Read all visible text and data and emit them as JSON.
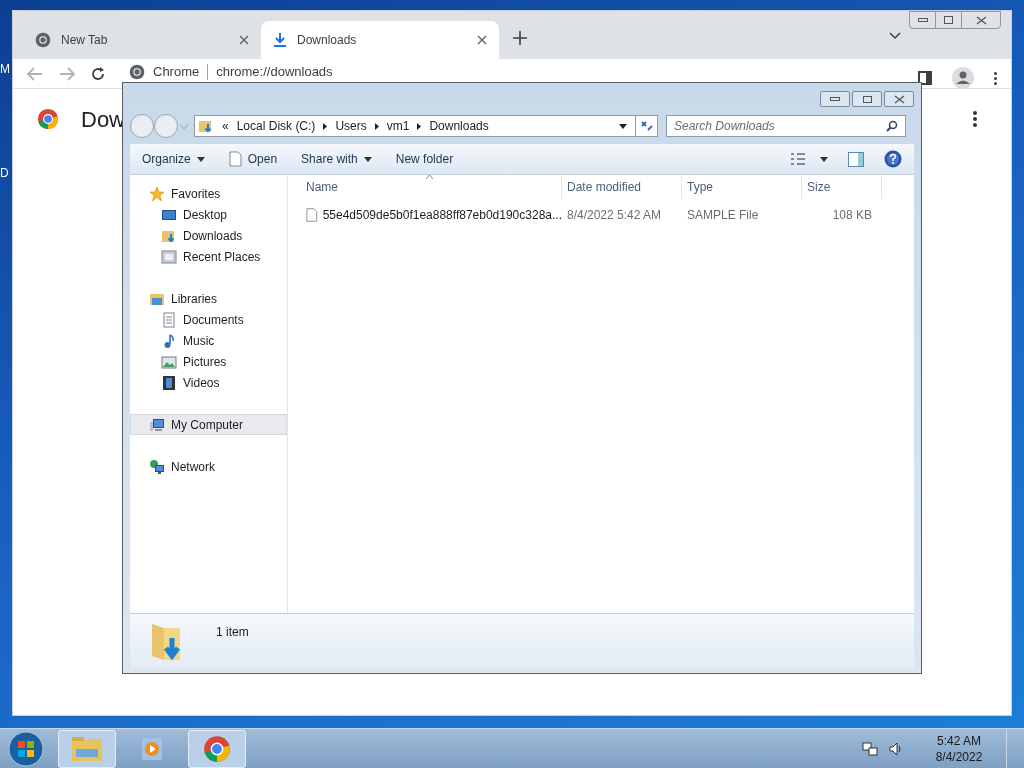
{
  "desktop_labels": [
    "M",
    "D"
  ],
  "browser": {
    "tabs": [
      {
        "title": "New Tab",
        "selected": false,
        "kind": "chrome"
      },
      {
        "title": "Downloads",
        "selected": true,
        "kind": "download"
      }
    ],
    "omnibox": {
      "chip": "Chrome",
      "url": "chrome://downloads"
    },
    "page_title": "Dow"
  },
  "explorer": {
    "breadcrumb_overflow": "«",
    "breadcrumb": [
      "Local Disk (C:)",
      "Users",
      "vm1",
      "Downloads"
    ],
    "search": {
      "placeholder": "Search Downloads"
    },
    "commands": [
      {
        "label": "Organize",
        "kind": "menu"
      },
      {
        "label": "Open",
        "kind": "open"
      },
      {
        "label": "Share with",
        "kind": "menu"
      },
      {
        "label": "New folder",
        "kind": "plain"
      }
    ],
    "nav": [
      {
        "label": "Favorites",
        "kind": "star",
        "selected": false,
        "children": [
          {
            "label": "Desktop",
            "kind": "desktop",
            "selected": false
          },
          {
            "label": "Downloads",
            "kind": "downloads",
            "selected": false
          },
          {
            "label": "Recent Places",
            "kind": "recent",
            "selected": false
          }
        ]
      },
      {
        "label": "Libraries",
        "kind": "library",
        "selected": false,
        "children": [
          {
            "label": "Documents",
            "kind": "document",
            "selected": false
          },
          {
            "label": "Music",
            "kind": "music",
            "selected": false
          },
          {
            "label": "Pictures",
            "kind": "pictures",
            "selected": false
          },
          {
            "label": "Videos",
            "kind": "video",
            "selected": false
          }
        ]
      },
      {
        "label": "My Computer",
        "kind": "computer",
        "selected": true
      },
      {
        "label": "Network",
        "kind": "network",
        "selected": false
      }
    ],
    "columns": [
      "Name",
      "Date modified",
      "Type",
      "Size"
    ],
    "rows": [
      {
        "name": "55e4d509de5b0f1ea888ff87eb0d190c328a...",
        "date": "8/4/2022 5:42 AM",
        "type": "SAMPLE File",
        "size": "108 KB",
        "selected": false
      }
    ],
    "status": "1 item"
  },
  "taskbar": {
    "apps": [
      {
        "kind": "explorer"
      },
      {
        "kind": "media"
      },
      {
        "kind": "chrome"
      }
    ],
    "clock": {
      "time": "5:42 AM",
      "date": "8/4/2022"
    }
  }
}
